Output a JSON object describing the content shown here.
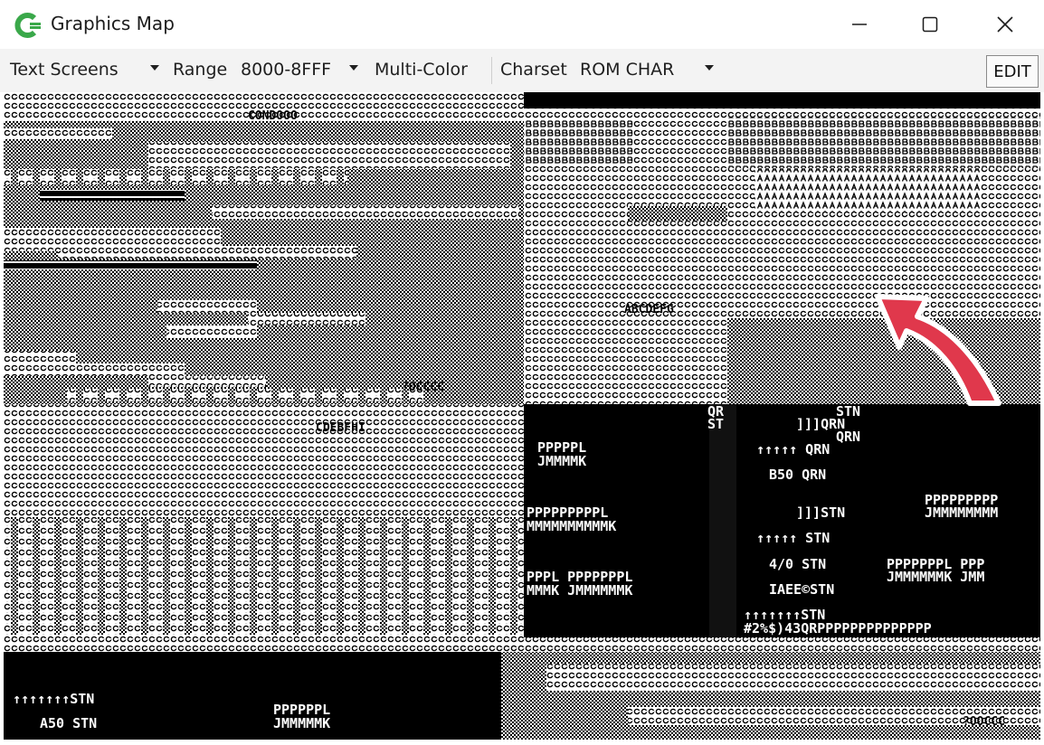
{
  "window": {
    "title": "Graphics Map",
    "minimize_icon": "minimize-icon",
    "maximize_icon": "maximize-icon",
    "close_icon": "close-icon"
  },
  "toolbar": {
    "mode_value": "Text Screens",
    "range_label": "Range",
    "range_value": "8000-8FFF",
    "multicolor_label": "Multi-Color",
    "charset_label": "Charset",
    "charset_value": "ROM CHAR",
    "edit_label": "EDIT"
  },
  "canvas": {
    "text_fragments": [
      "PPPPPL",
      "JMMMMK",
      "PPPPPPPPPL",
      "MMMMMMMMMMK",
      "PPPL PPPPPPPL",
      "MMMK JMMMMMMK",
      "QR",
      "ST",
      "STN",
      "QRN",
      "]]]QRN",
      "↑↑↑↑↑ QRN",
      "B50 QRN",
      "]]]STN",
      "↑↑↑↑↑ STN",
      "4/0 STN",
      "IAEE©STN",
      "↑↑↑↑↑↑↑STN",
      "#2%$)43QRPPPPPPPPPPPPPP",
      "PPPPPPPPP",
      "JMMMMMMMM",
      "PPPPPPPL PPP",
      "JMMMMMMK JMM",
      "↑↑↑↑↑↑↑STN",
      "A50 STN",
      "PPPPPPL",
      "JMMMMMK",
      "ABCDEFG",
      "CDEBFHI",
      "?OCCCC",
      "CONDOOO",
      "?OOCCC"
    ],
    "annotation": "red-arrow-pointer"
  },
  "colors": {
    "canvas_bg": "#000000",
    "canvas_fg": "#ffffff",
    "arrow": "#e0384c",
    "icon_green": "#3aa84a"
  }
}
